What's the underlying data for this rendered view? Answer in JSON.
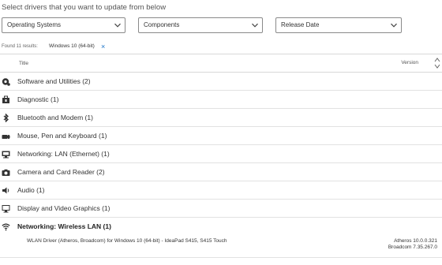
{
  "intro_text": "Select drivers that you want to update from below",
  "filters": {
    "os": "Operating Systems",
    "components": "Components",
    "release_date": "Release Date"
  },
  "results": {
    "found_text": "Found 11 results:",
    "chip_label": "Windows 10 (64-bit)",
    "chip_remove": "×"
  },
  "table": {
    "title_header": "Title",
    "version_header": "Version"
  },
  "categories": [
    {
      "label": "Software and Utilities (2)",
      "icon": "software-icon"
    },
    {
      "label": "Diagnostic (1)",
      "icon": "diagnostic-icon"
    },
    {
      "label": "Bluetooth and Modem (1)",
      "icon": "bluetooth-icon"
    },
    {
      "label": "Mouse, Pen and Keyboard (1)",
      "icon": "keyboard-icon"
    },
    {
      "label": "Networking: LAN (Ethernet) (1)",
      "icon": "ethernet-icon"
    },
    {
      "label": "Camera and Card Reader (2)",
      "icon": "camera-icon"
    },
    {
      "label": "Audio (1)",
      "icon": "speaker-icon"
    },
    {
      "label": "Display and Video Graphics (1)",
      "icon": "display-icon"
    },
    {
      "label": "Networking: Wireless LAN (1)",
      "icon": "wifi-icon",
      "expanded": true
    }
  ],
  "driver": {
    "name": "WLAN Driver (Atheros, Broadcom) for Windows 10 (64-bit) - IdeaPad S415, S415 Touch",
    "version_1": "Atheros 10.0.0.321",
    "version_2": "Broadcom 7.35.267.0"
  },
  "colors": {
    "accent": "#1a73c8",
    "text": "#333333",
    "border": "#8a8a8a",
    "divider": "#e2e2e2"
  }
}
